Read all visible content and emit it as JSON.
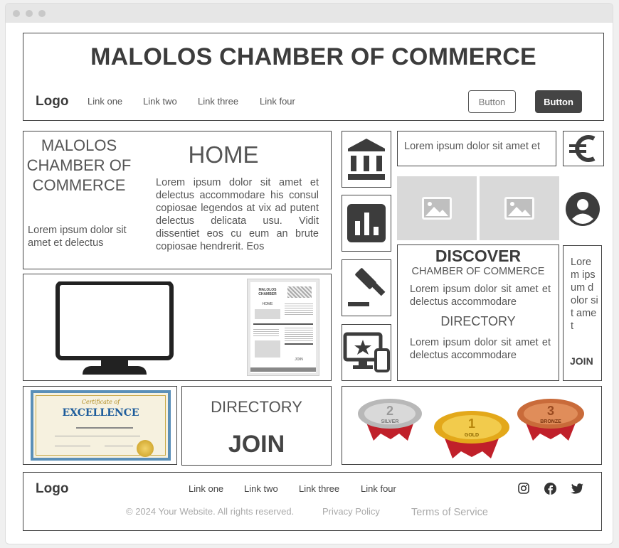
{
  "header": {
    "title": "MALOLOS CHAMBER OF COMMERCE",
    "logo": "Logo",
    "nav": [
      "Link one",
      "Link two",
      "Link three",
      "Link four"
    ],
    "button_outline": "Button",
    "button_solid": "Button"
  },
  "hero": {
    "side_title": "MALOLOS CHAMBER OF COMMERCE",
    "side_text": "Lorem ipsum dolor sit amet et delectus",
    "home_title": "HOME",
    "home_text": "Lorem ipsum dolor sit amet et delectus accommodare his consul copiosae legendos at vix ad putent delectus delicata usu. Vidit dissentiet eos cu eum an brute copiosae hendrerit. Eos"
  },
  "preview": {
    "mini_title": "MALOLOS CHAMBER",
    "mini_home": "HOME",
    "mini_join": "JOIN"
  },
  "right": {
    "lorem_short": "Lorem ipsum dolor sit amet et",
    "discover_title": "DISCOVER",
    "discover_sub": "CHAMBER OF COMMERCE",
    "discover_text": "Lorem ipsum dolor sit amet et delectus accommodare",
    "directory_title": "DIRECTORY",
    "directory_text": "Lorem ipsum dolor sit amet et delectus accommodare",
    "narrow_text": "Lorem ipsum dolor sit amet",
    "narrow_join": "JOIN"
  },
  "certificate": {
    "heading": "Certificate of",
    "title": "EXCELLENCE"
  },
  "directory_box": {
    "title": "DIRECTORY",
    "join": "JOIN"
  },
  "medals": {
    "silver_num": "2",
    "silver_label": "SILVER",
    "gold_num": "1",
    "gold_label": "GOLD",
    "bronze_num": "3",
    "bronze_label": "BRONZE"
  },
  "footer": {
    "logo": "Logo",
    "nav": [
      "Link one",
      "Link two",
      "Link three",
      "Link four"
    ],
    "copyright": "© 2024 Your Website. All rights reserved.",
    "privacy": "Privacy Policy",
    "terms": "Terms of Service"
  },
  "icons": {
    "bank": "bank-icon",
    "chart": "bar-chart-icon",
    "gavel": "gavel-icon",
    "devices": "devices-icon",
    "euro": "euro-icon",
    "user": "user-icon",
    "instagram": "instagram-icon",
    "facebook": "facebook-icon",
    "twitter": "twitter-icon"
  },
  "colors": {
    "dark": "#444444",
    "placeholder": "#d9d9d9",
    "gold": "#e3a81a",
    "silver": "#b8b8b8",
    "bronze": "#c96b3a",
    "ribbon": "#c0202a"
  }
}
